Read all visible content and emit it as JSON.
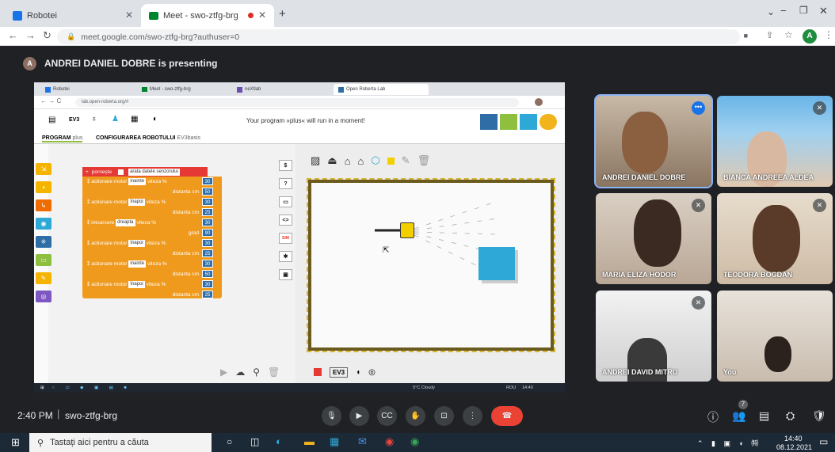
{
  "browser": {
    "tabs": [
      {
        "label": "Robotei",
        "icon_color": "#1a73e8"
      },
      {
        "label": "Meet - swo-ztfg-brg",
        "icon_color": "#00832d",
        "recording": true
      }
    ],
    "url": "meet.google.com/swo-ztfg-brg?authuser=0",
    "profile_initial": "A"
  },
  "presenting": {
    "avatar_initial": "A",
    "text": "ANDREI DANIEL DOBRE is presenting"
  },
  "shared": {
    "tabs": [
      "Robotei",
      "Meet - swo-ztfg-brg",
      "neXtlab",
      "Open Roberta Lab"
    ],
    "url": "lab.open-roberta.org/#",
    "toolbar_message": "Your program »plus« will run in a moment!",
    "robot_label": "EV3",
    "menu": {
      "program": "PROGRAM",
      "program_name": "plus",
      "config": "CONFIGURAREA ROBOTULUI",
      "config_name": "EV3basis"
    },
    "blocks": {
      "start": "pornește",
      "show_sensors": "arata datele senzorului",
      "rows": [
        {
          "label": "actionare motor",
          "dir": "inainte",
          "speed_label": "viteza %",
          "speed": "30",
          "dist_label": "distanta cm",
          "dist": "50"
        },
        {
          "label": "actionare motor",
          "dir": "înapoi",
          "speed_label": "viteza %",
          "speed": "30",
          "dist_label": "distanta cm",
          "dist": "25"
        },
        {
          "label": "intoarcere",
          "dir": "dreapta",
          "speed_label": "viteza %",
          "speed": "30",
          "dist_label": "grad",
          "dist": "90"
        },
        {
          "label": "actionare motor",
          "dir": "înapoi",
          "speed_label": "viteza %",
          "speed": "30",
          "dist_label": "distanta cm",
          "dist": "25"
        },
        {
          "label": "actionare motor",
          "dir": "inainte",
          "speed_label": "viteza %",
          "speed": "30",
          "dist_label": "distanta cm",
          "dist": "50"
        },
        {
          "label": "actionare motor",
          "dir": "înapoi",
          "speed_label": "viteza %",
          "speed": "30",
          "dist_label": "distanta cm",
          "dist": "25"
        }
      ]
    },
    "side_buttons": [
      "$",
      "?",
      "▭",
      "<>",
      "SIM",
      "✱",
      "▣"
    ],
    "sim_bottom_label": "EV3",
    "taskbar_weather": "5°C Cloudy",
    "taskbar_lang": "ROU",
    "taskbar_time": "14:40"
  },
  "participants": [
    {
      "name": "ANDREI DANIEL DOBRE",
      "muted": false,
      "active": true
    },
    {
      "name": "BIANCA ANDREEA ALDEA",
      "muted": true
    },
    {
      "name": "MARIA ELIZA HODOR",
      "muted": true
    },
    {
      "name": "TEODORA BOGDAN",
      "muted": true
    },
    {
      "name": "ANDREI DAVID MITRU",
      "muted": true
    },
    {
      "name": "You",
      "muted": false
    }
  ],
  "meeting": {
    "time": "2:40 PM",
    "code": "swo-ztfg-brg",
    "participant_count": "7"
  },
  "windows": {
    "search_placeholder": "Tastați aici pentru a căuta",
    "time": "14:40",
    "date": "08.12.2021"
  },
  "colors": {
    "end_call": "#ea4335",
    "block_orange": "#ef9a1d",
    "block_red": "#e53935",
    "sim_box": "#2ea8d6",
    "nepo_blue": "#2f6da7",
    "nepo_yellow": "#f2b41c",
    "nepo_green": "#8fbf3f"
  }
}
